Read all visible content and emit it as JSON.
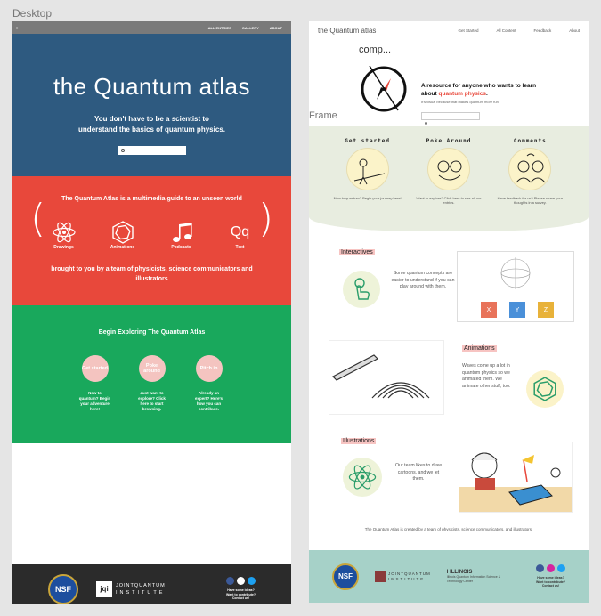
{
  "labels": {
    "desktop": "Desktop",
    "frame": "Frame"
  },
  "desktop": {
    "nav": {
      "menu_glyph": "≡",
      "links": [
        "ALL ENTRIES",
        "GALLERY",
        "ABOUT"
      ]
    },
    "logo": {
      "the": "the",
      "quantum": "Quantum",
      "atlas": "atlas"
    },
    "tagline": "You don't have to be a scientist to understand the basics of quantum physics.",
    "intro": "The Quantum Atlas is a multimedia guide to an unseen world",
    "media": [
      {
        "label": "Drawings",
        "icon": "atom-icon"
      },
      {
        "label": "Animations",
        "icon": "hexagon-icon"
      },
      {
        "label": "Podcasts",
        "icon": "music-note-icon"
      },
      {
        "label": "Text",
        "icon": "text-icon",
        "glyph": "Qq"
      }
    ],
    "outro": "brought to you by a team of physicists, science communicators and illustrators",
    "explore_heading": "Begin Exploring The Quantum Atlas",
    "explore": [
      {
        "button": "Get started",
        "text": "New to quantum? Begin your adventure here!"
      },
      {
        "button": "Poke around",
        "text": "Just want to explore? Click here to start browsing."
      },
      {
        "button": "Pitch in",
        "text": "Already an expert? Here's how you can contribute."
      }
    ],
    "footer": {
      "nsf": "NSF",
      "jqi_top": "JOINTQUANTUM",
      "jqi_bottom": "INSTITUTE",
      "jqi_mark": "jqi",
      "contact": [
        "Have some ideas?",
        "Want to contribute?",
        "Contact us!"
      ]
    }
  },
  "frame": {
    "nav": {
      "brand_the": "the",
      "brand_rest": "Quantum atlas",
      "links": [
        "Get Started",
        "All Content",
        "Feedback",
        "About"
      ]
    },
    "comp": "comp...",
    "hero_pre": "A resource for anyone who wants to learn about",
    "hero_red": "quantum physics",
    "hero_post": ".",
    "hero_sub": "It's visual because that makes quantum more fun.",
    "cards": [
      {
        "title": "Get started",
        "text": "New to quantum? Begin your journey here!"
      },
      {
        "title": "Poke Around",
        "text": "Want to explore? Click here to see all our entries."
      },
      {
        "title": "Comments",
        "text": "Have feedback for us? Please share your thoughts in a survey."
      }
    ],
    "interactives": {
      "label": "Interactives",
      "text": "Some quantum concepts are easier to understand if you can play around with them.",
      "gates": [
        "X",
        "Y",
        "Z"
      ]
    },
    "animations": {
      "label": "Animations",
      "text": "Waves come up a lot in quantum physics so we animated them. We animate other stuff, too."
    },
    "illustrations": {
      "label": "Illustrations",
      "text": "Our team likes to draw cartoons, and we let them."
    },
    "credit": "The Quantum Atlas is created by a team of physicists, science communicators, and illustrators.",
    "footer": {
      "nsf": "NSF",
      "jqi_top": "JOINTQUANTUM",
      "jqi_bottom": "INSTITUTE",
      "illinois": "I ILLINOIS",
      "iqui": "Illinois Quantum Information Science & Technology Center",
      "contact": [
        "Have some ideas?",
        "Want to contribute?",
        "Contact us!"
      ]
    }
  },
  "colors": {
    "blue": "#2e5a80",
    "red": "#e8483b",
    "green": "#19a85c",
    "dark": "#2b2b2b",
    "teal": "#a6d1c8",
    "cream": "#e8ede0"
  }
}
